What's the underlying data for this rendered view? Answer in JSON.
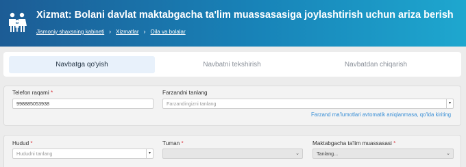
{
  "header": {
    "title": "Xizmat: Bolani davlat maktabgacha ta'lim muassasasiga joylashtirish uchun ariza berish",
    "breadcrumbs": [
      "Jismoniy shaxsning kabineti",
      "Xizmatlar",
      "Oila va bolalar"
    ]
  },
  "tabs": [
    {
      "label": "Navbatga qo'yish",
      "active": true
    },
    {
      "label": "Navbatni tekshirish",
      "active": false
    },
    {
      "label": "Navbatdan chiqarish",
      "active": false
    }
  ],
  "form1": {
    "phone_label": "Telefon raqami",
    "phone_value": "998885053938",
    "child_label": "Farzandni tanlang",
    "child_placeholder": "Farzandingizni tanlang",
    "manual_link": "Farzand ma'lumotlari avtomatik aniqlanmasa, qo'lda kiriting"
  },
  "form2": {
    "region_label": "Hudud",
    "region_placeholder": "Hududni tanlang",
    "district_label": "Tuman",
    "district_value": "",
    "school_label": "Maktabgacha ta'lim muassasasi",
    "school_value": "Tanlang..."
  },
  "colors": {
    "header_start": "#1c5c95",
    "header_end": "#1ea7cf",
    "required": "#d9363e",
    "link": "#3a8fd6"
  },
  "icons": {
    "logo": "family-icon",
    "separator": "chevron-right-icon"
  }
}
